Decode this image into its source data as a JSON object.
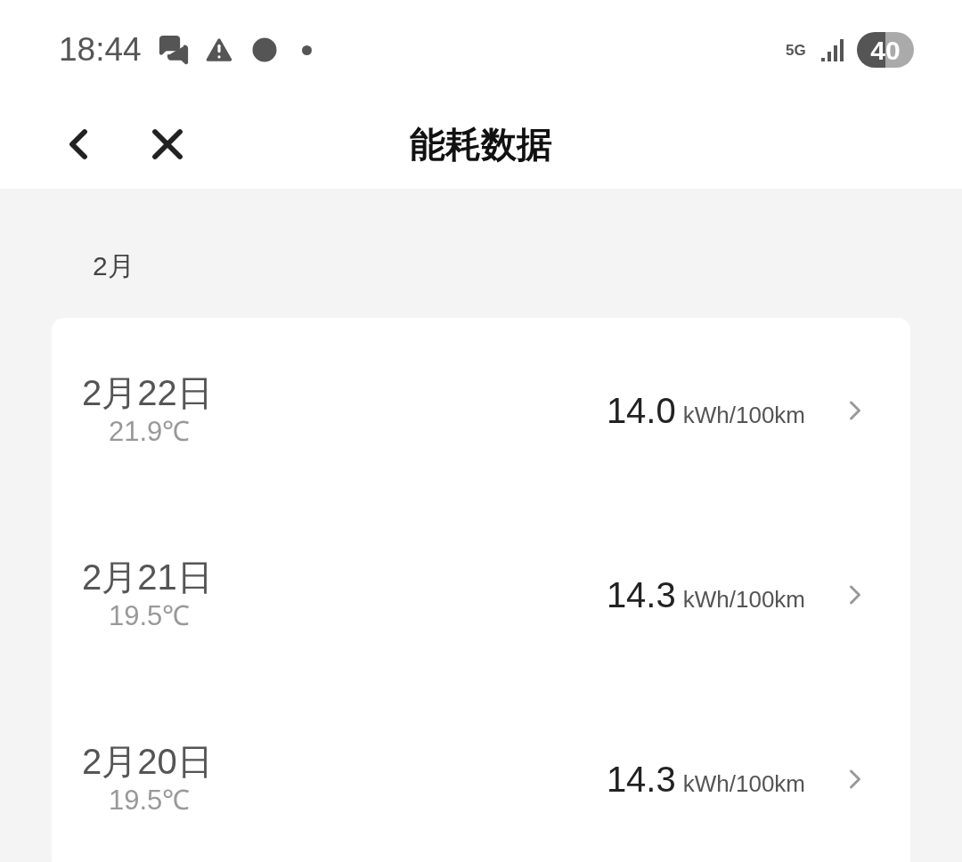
{
  "status_bar": {
    "time": "18:44",
    "network": "5G",
    "battery": "40"
  },
  "header": {
    "title": "能耗数据"
  },
  "month": "2月",
  "records": [
    {
      "date": "2月22日",
      "temperature": "21.9℃",
      "value": "14.0",
      "unit": "kWh/100km"
    },
    {
      "date": "2月21日",
      "temperature": "19.5℃",
      "value": "14.3",
      "unit": "kWh/100km"
    },
    {
      "date": "2月20日",
      "temperature": "19.5℃",
      "value": "14.3",
      "unit": "kWh/100km"
    }
  ]
}
